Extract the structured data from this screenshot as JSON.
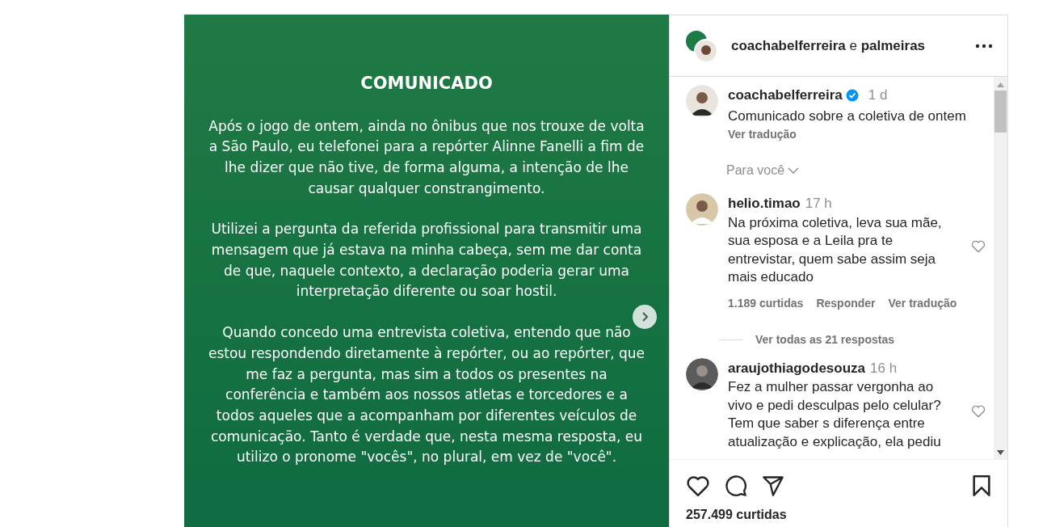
{
  "post": {
    "title": "COMUNICADO",
    "paragraphs": [
      "Após o jogo de ontem, ainda no ônibus que nos trouxe de volta a São Paulo, eu telefonei para a repórter Alinne Fanelli a fim de lhe dizer que não tive, de forma alguma, a intenção de lhe causar qualquer constrangimento.",
      "Utilizei a pergunta da referida profissional para transmitir uma mensagem que já estava na minha cabeça, sem me dar conta de que, naquele contexto, a declaração poderia gerar uma interpretação diferente ou soar hostil.",
      "Quando concedo uma entrevista coletiva, entendo que não estou respondendo diretamente à repórter, ou ao repórter, que me faz a pergunta, mas sim a todos os presentes na conferência e também aos nossos atletas e torcedores e a todos aqueles que a acompanham por diferentes veículos de comunicação. Tanto é verdade que, nesta mesma resposta, eu utilizo o pronome \"vocês\", no plural, em vez de \"você\"."
    ]
  },
  "header": {
    "author": "coachabelferreira",
    "joiner": "e",
    "coauthor": "palmeiras"
  },
  "caption": {
    "user": "coachabelferreira",
    "verified": true,
    "time": "1 d",
    "text": "Comunicado sobre a coletiva de ontem",
    "translate": "Ver tradução"
  },
  "sort": "Para você",
  "comments": [
    {
      "user": "helio.timao",
      "time": "17 h",
      "text": "Na próxima coletiva, leva sua mãe, sua esposa e a Leila pra te entrevistar, quem sabe assim seja mais educado",
      "likes": "1.189 curtidas",
      "reply": "Responder",
      "translate": "Ver tradução",
      "replies": "Ver todas as 21 respostas",
      "liked": false
    },
    {
      "user": "araujothiagodesouza",
      "time": "16 h",
      "text": "Fez a mulher passar vergonha ao vivo e pedi desculpas pelo celular? Tem que saber s diferença entre atualização e explicação, ela pediu",
      "liked": false
    }
  ],
  "likes": "257.499 curtidas"
}
